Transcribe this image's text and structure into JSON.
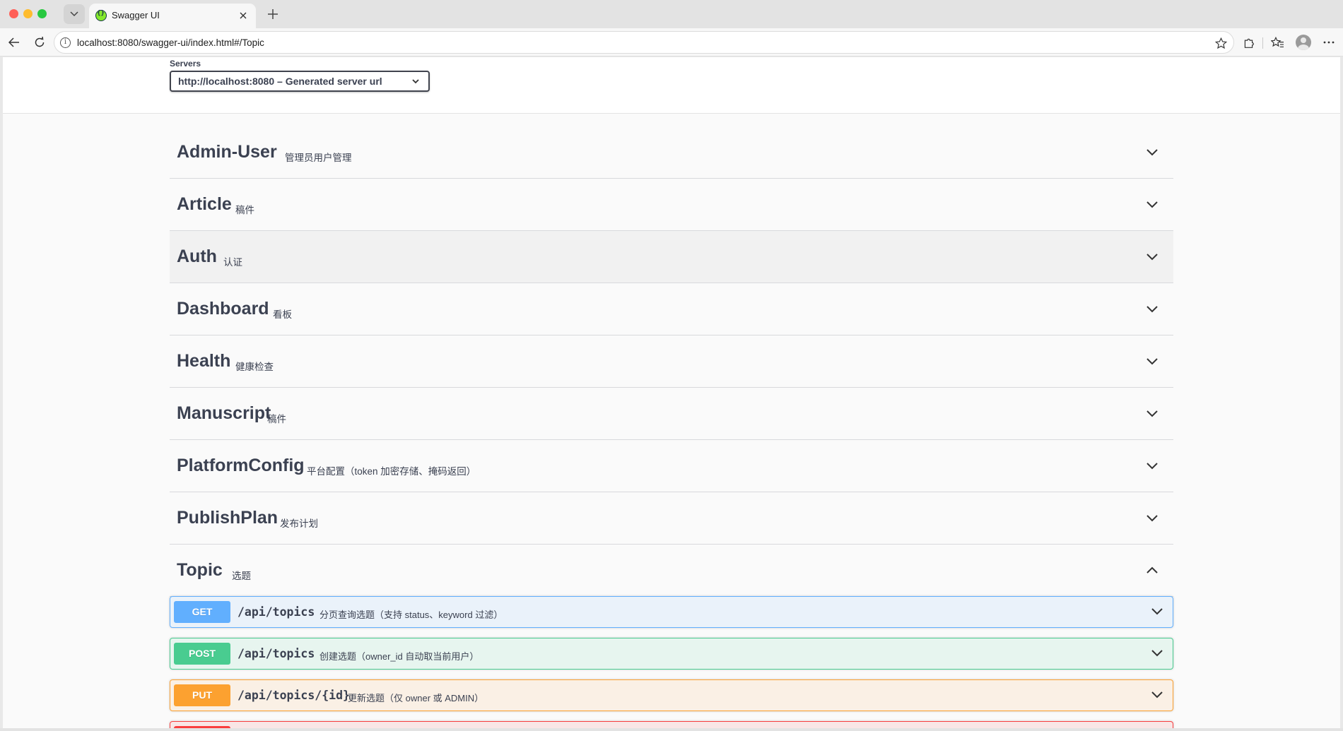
{
  "browser": {
    "tab_title": "Swagger UI",
    "url": "localhost:8080/swagger-ui/index.html#/Topic",
    "icons": [
      "tab-list-icon",
      "swagger-favicon",
      "close-icon",
      "plus-icon",
      "back-arrow-icon",
      "reload-icon",
      "info-icon",
      "star-icon",
      "extensions-icon",
      "favorites-icon",
      "profile-icon",
      "more-icon"
    ]
  },
  "servers": {
    "label": "Servers",
    "selected": "http://localhost:8080 – Generated server url"
  },
  "tags": [
    {
      "name": "Admin-User",
      "description": "管理员用户管理",
      "expanded": false
    },
    {
      "name": "Article",
      "description": "稿件",
      "expanded": false
    },
    {
      "name": "Auth",
      "description": "认证",
      "expanded": false
    },
    {
      "name": "Dashboard",
      "description": "看板",
      "expanded": false
    },
    {
      "name": "Health",
      "description": "健康检查",
      "expanded": false
    },
    {
      "name": "Manuscript",
      "description": "稿件",
      "expanded": false
    },
    {
      "name": "PlatformConfig",
      "description": "平台配置（token 加密存储、掩码返回）",
      "expanded": false
    },
    {
      "name": "PublishPlan",
      "description": "发布计划",
      "expanded": false
    },
    {
      "name": "Topic",
      "description": "选题",
      "expanded": true
    }
  ],
  "operations": [
    {
      "method": "GET",
      "path": "/api/topics",
      "summary": "分页查询选题（支持 status、keyword 过滤）"
    },
    {
      "method": "POST",
      "path": "/api/topics",
      "summary": "创建选题（owner_id 自动取当前用户）"
    },
    {
      "method": "PUT",
      "path": "/api/topics/{id}",
      "summary": "更新选题（仅 owner 或 ADMIN）"
    }
  ],
  "colors": {
    "get": "#61affe",
    "post": "#49cc90",
    "put": "#fca130",
    "delete": "#f93e3e",
    "text": "#3b4151"
  }
}
